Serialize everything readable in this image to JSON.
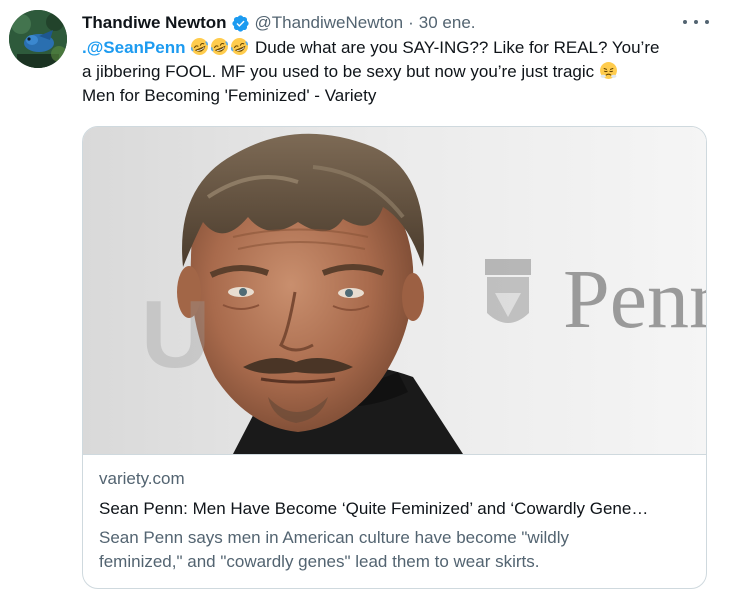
{
  "tweet": {
    "display_name": "Thandiwe Newton",
    "verified": true,
    "handle": "@ThandiweNewton",
    "separator": "·",
    "date": "30 ene.",
    "mention": ".@SeanPenn",
    "text_line1_rest": "Dude what are you SAY-ING?? Like for REAL? You’re",
    "text_line2": "a jibbering FOOL. MF you used to be sexy but now you’re just tragic",
    "text_line3": "Men for Becoming 'Feminized' - Variety",
    "emojis": [
      "rolling-on-floor-laughing",
      "rolling-on-floor-laughing",
      "rolling-on-floor-laughing",
      "face-with-steam-from-nose"
    ]
  },
  "card": {
    "image_backdrop_text": "Penn",
    "image_backdrop_partial": "U",
    "domain": "variety.com",
    "title": "Sean Penn: Men Have Become ‘Quite Feminized’ and ‘Cowardly Gene…",
    "description_line1": "Sean Penn says men in American culture have become \"wildly",
    "description_line2": "feminized,\" and \"cowardly genes\" lead them to wear skirts."
  },
  "colors": {
    "link": "#1d9bf0",
    "secondary_text": "#536471",
    "primary_text": "#0f1419",
    "border": "#cfd9de"
  }
}
